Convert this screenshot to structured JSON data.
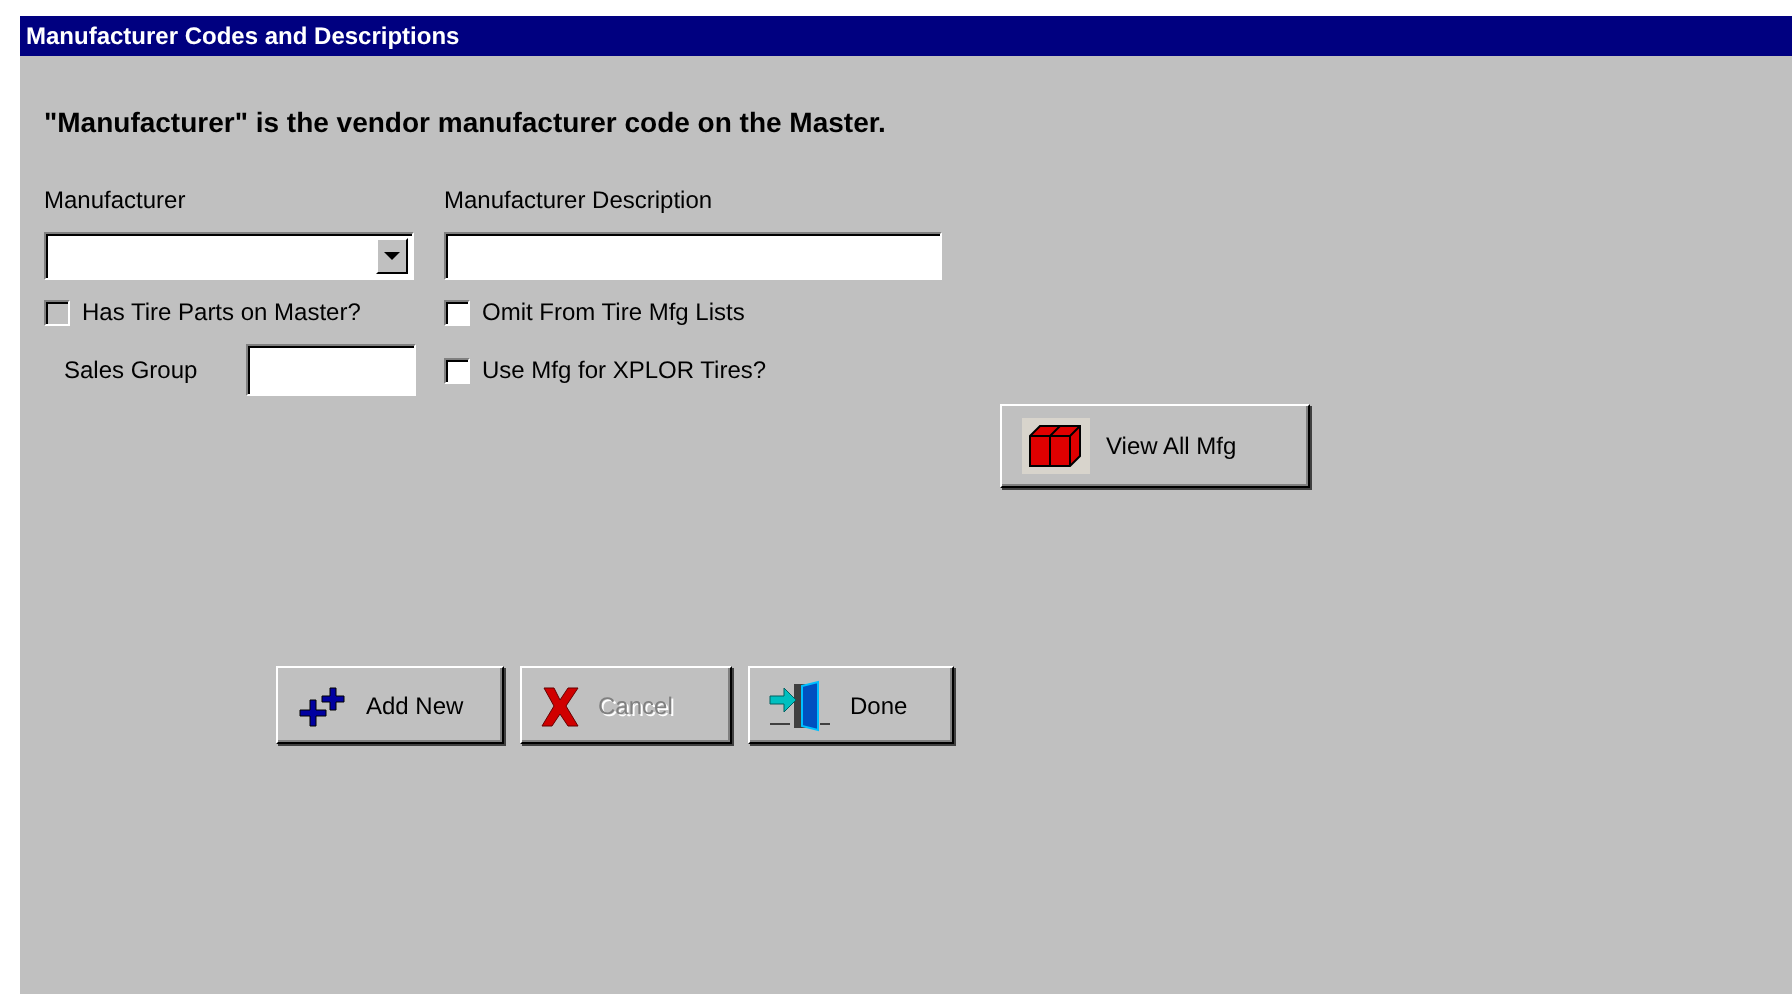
{
  "window": {
    "title": "Manufacturer Codes and Descriptions"
  },
  "heading": "\"Manufacturer\" is the vendor manufacturer code on the Master.",
  "manufacturer": {
    "label": "Manufacturer"
  },
  "description": {
    "label": "Manufacturer Description"
  },
  "checkboxes": [
    {
      "label": "Has Tire Parts on Master?",
      "checked": false,
      "disabled": true
    },
    {
      "label": "Omit From Tire Mfg Lists",
      "checked": false,
      "disabled": false
    },
    {
      "label": "Use Mfg for XPLOR Tires?",
      "checked": false,
      "disabled": false
    }
  ],
  "sales_group": {
    "label": "Sales Group"
  },
  "view_button": {
    "label": "View All Mfg"
  },
  "buttons": [
    {
      "kind": "add",
      "label": "Add New",
      "disabled": false
    },
    {
      "kind": "cancel",
      "label": "Cancel",
      "disabled": true
    },
    {
      "kind": "done",
      "label": "Done",
      "disabled": false
    }
  ]
}
